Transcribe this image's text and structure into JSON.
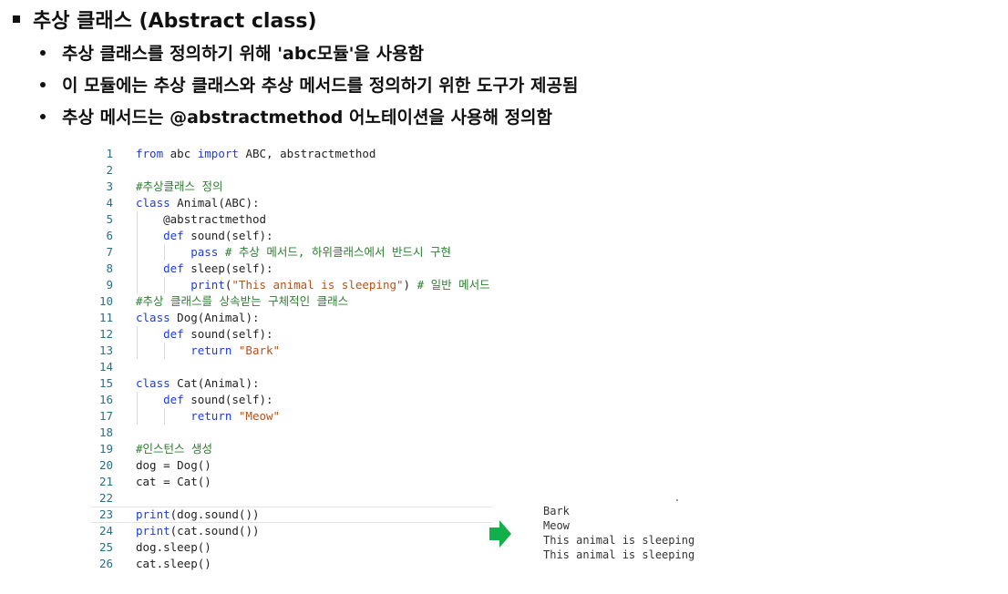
{
  "heading": "추상 클래스 (Abstract class)",
  "bullets": [
    "추상 클래스를 정의하기 위해 'abc모듈'을 사용함",
    "이 모듈에는 추상 클래스와 추상 메서드를 정의하기 위한 도구가 제공됨",
    "추상 메서드는 @abstractmethod 어노테이션을 사용해 정의함"
  ],
  "code_lines": [
    "from abc import ABC, abstractmethod",
    "",
    "#추상클래스 정의",
    "class Animal(ABC):",
    "    @abstractmethod",
    "    def sound(self):",
    "        pass # 추상 메서드, 하위클래스에서 반드시 구현",
    "    def sleep(self):",
    "        print(\"This animal is sleeping\") # 일반 메서드",
    "#추상 클래스를 상속받는 구체적인 클래스",
    "class Dog(Animal):",
    "    def sound(self):",
    "        return \"Bark\"",
    "",
    "class Cat(Animal):",
    "    def sound(self):",
    "        return \"Meow\"",
    "",
    "#인스턴스 생성",
    "dog = Dog()",
    "cat = Cat()",
    "",
    "print(dog.sound())",
    "print(cat.sound())",
    "dog.sleep()",
    "cat.sleep()"
  ],
  "highlighted_lines": [
    23
  ],
  "output_lines": [
    "Bark",
    "Meow",
    "This animal is sleeping",
    "This animal is sleeping"
  ],
  "colors": {
    "keyword": "#1a3fd6",
    "comment": "#2e7d32",
    "string": "#b3541e",
    "line_number": "#2b6e86",
    "arrow": "#12b04a"
  },
  "icons": {
    "result_arrow": "right-arrow-icon"
  }
}
